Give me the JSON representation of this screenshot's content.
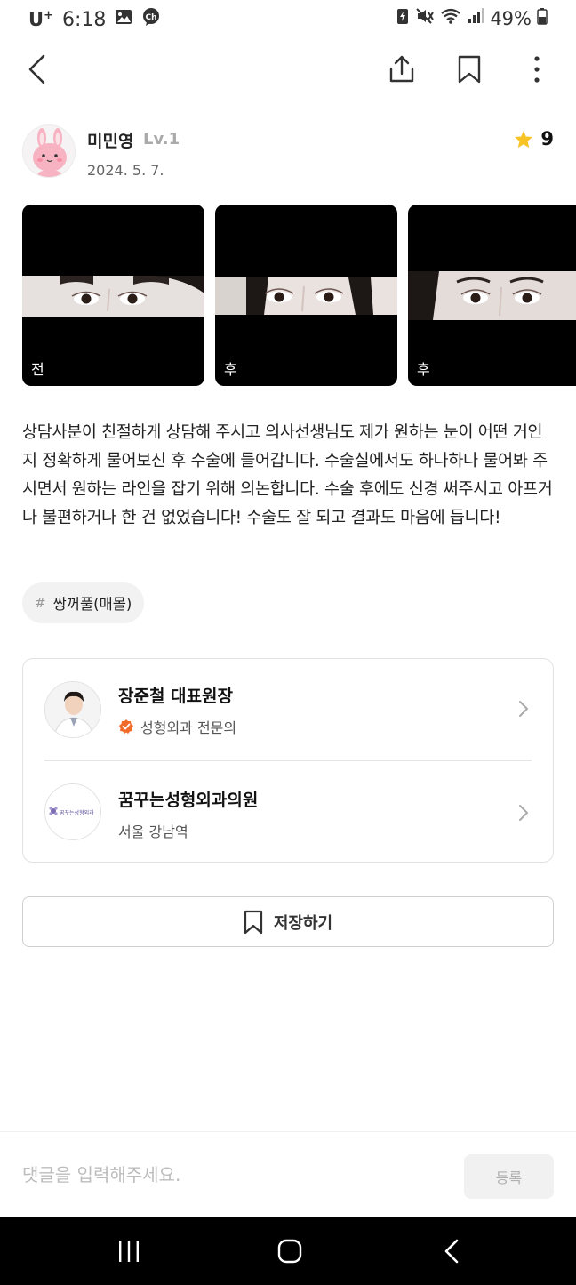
{
  "status_bar": {
    "carrier": "U",
    "carrier_sup": "+",
    "time": "6:18",
    "battery": "49%"
  },
  "toolbar": {
    "back_icon": "chevron-left-icon",
    "share_icon": "share-icon",
    "bookmark_icon": "bookmark-icon",
    "more_icon": "more-vertical-icon"
  },
  "author": {
    "name": "미민영",
    "level": "Lv.1",
    "date": "2024. 5. 7.",
    "rating": "9",
    "rating_color": "#f7c325"
  },
  "photos": [
    {
      "label": "전"
    },
    {
      "label": "후"
    },
    {
      "label": "후"
    }
  ],
  "review": {
    "text": "상담사분이 친절하게 상담해 주시고 의사선생님도 제가 원하는 눈이 어떤 거인지 정확하게 물어보신 후 수술에 들어갑니다. 수술실에서도 하나하나 물어봐 주시면서 원하는 라인을 잡기 위해 의논합니다. 수술 후에도 신경 써주시고 아프거나 불편하거나 한 건 없었습니다! 수술도 잘 되고 결과도 마음에 듭니다!"
  },
  "tag": {
    "hash": "#",
    "label": "쌍꺼풀(매몰)"
  },
  "doctor": {
    "name": "장준철 대표원장",
    "specialty": "성형외과 전문의",
    "badge_color": "#f26b2a"
  },
  "clinic": {
    "name": "꿈꾸는성형외과의원",
    "location": "서울 강남역",
    "logo_text": "꿈꾸는성형외과"
  },
  "save_button": {
    "label": "저장하기"
  },
  "comment": {
    "placeholder": "댓글을 입력해주세요.",
    "submit_label": "등록"
  }
}
